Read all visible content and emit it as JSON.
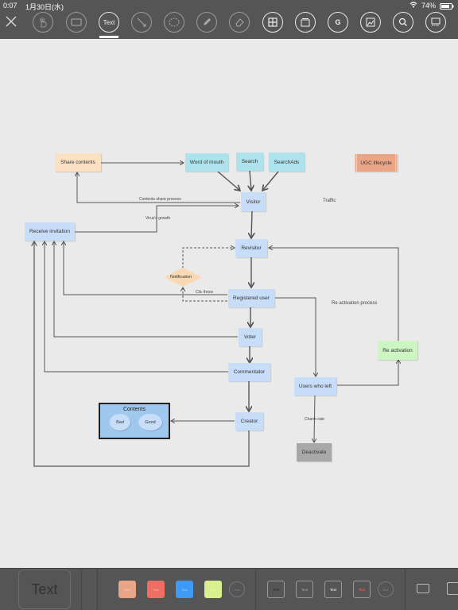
{
  "status_bar": {
    "time": "0:07",
    "date": "1月30日(水)",
    "battery": "74%"
  },
  "toolbar": {
    "close_label": "×",
    "tools": [
      {
        "name": "hand-tool",
        "icon": "hand-icon"
      },
      {
        "name": "rectangle-tool",
        "icon": "rectangle-icon"
      },
      {
        "name": "text-tool",
        "label": "Text",
        "selected": true
      },
      {
        "name": "line-tool",
        "icon": "line-icon"
      },
      {
        "name": "ellipse-tool",
        "icon": "dashed-circle-icon"
      },
      {
        "name": "pencil-tool",
        "icon": "pencil-icon"
      },
      {
        "name": "eraser-tool",
        "icon": "eraser-icon"
      },
      {
        "name": "grid-tool",
        "icon": "grid-icon"
      },
      {
        "name": "layers-tool",
        "icon": "layers-icon"
      },
      {
        "name": "g-tool",
        "label": "G"
      },
      {
        "name": "image-tool",
        "icon": "image-icon"
      },
      {
        "name": "search-tool",
        "icon": "search-icon"
      },
      {
        "name": "layout-tool",
        "icon": "layout-icon"
      }
    ]
  },
  "diagram": {
    "nodes": {
      "share_contents": "Share contents",
      "word_of_mouth": "Word of mouth",
      "search": "Search",
      "search_ads": "SearchAds",
      "ugc_lifecycle": "UGC lifecycle",
      "visitor": "Visitor",
      "receive_invitation": "Receive invitation",
      "revisitor": "Revisitor",
      "notification": "Notification",
      "registered_user": "Registered user",
      "voter": "Voter",
      "commentator": "Commentator",
      "creator": "Creator",
      "users_who_left": "Users who left",
      "re_activation": "Re activation",
      "deactivate": "Deactivate",
      "contents": "Contents",
      "bad": "Bad",
      "good": "Good"
    },
    "labels": {
      "traffic": "Traffic",
      "contents_share_process": "Contents share process",
      "virus_growth": "Virus's growth",
      "clic_throw": "Clic throw",
      "re_activation_process": "Re activation process",
      "churn_rate": "Charm rate"
    },
    "colors": {
      "share": "#fbe0c3",
      "cyan": "#aee3ee",
      "blue": "#c8ddf8",
      "ugc": "#e9a585",
      "green": "#ccf5c2",
      "gray": "#a8a8a8",
      "notification": "#f8d9b4",
      "contents_box": "#a0c8ee"
    }
  },
  "bottom_bar": {
    "preview_label": "Text",
    "swatch_label": "Text",
    "swatches": [
      "#e8a587",
      "#ee6e66",
      "#3d9bf5",
      "#d8f08f"
    ],
    "text_styles": [
      {
        "label": "Text",
        "color": "#222222"
      },
      {
        "label": "Text",
        "color": "#aaaaaa"
      },
      {
        "label": "Text",
        "color": "#ffffff"
      },
      {
        "label": "Text",
        "color": "#e96a62"
      }
    ],
    "more_label": "●●●"
  }
}
